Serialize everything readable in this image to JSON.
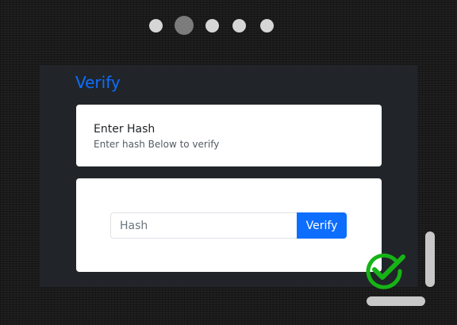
{
  "carousel": {
    "dots": [
      {
        "name": "step-1",
        "active": false
      },
      {
        "name": "step-2",
        "active": true
      },
      {
        "name": "step-3",
        "active": false
      },
      {
        "name": "step-4",
        "active": false
      },
      {
        "name": "step-5",
        "active": false
      }
    ]
  },
  "panel": {
    "title": "Verify"
  },
  "header_card": {
    "heading": "Enter Hash",
    "subtext": "Enter hash Below to verify"
  },
  "form": {
    "input_placeholder": "Hash",
    "input_value": "",
    "button_label": "Verify"
  },
  "colors": {
    "accent": "#0d6efd",
    "panel_bg": "#212529",
    "check": "#16b316"
  },
  "icons": {
    "check": "check-circle-icon"
  }
}
